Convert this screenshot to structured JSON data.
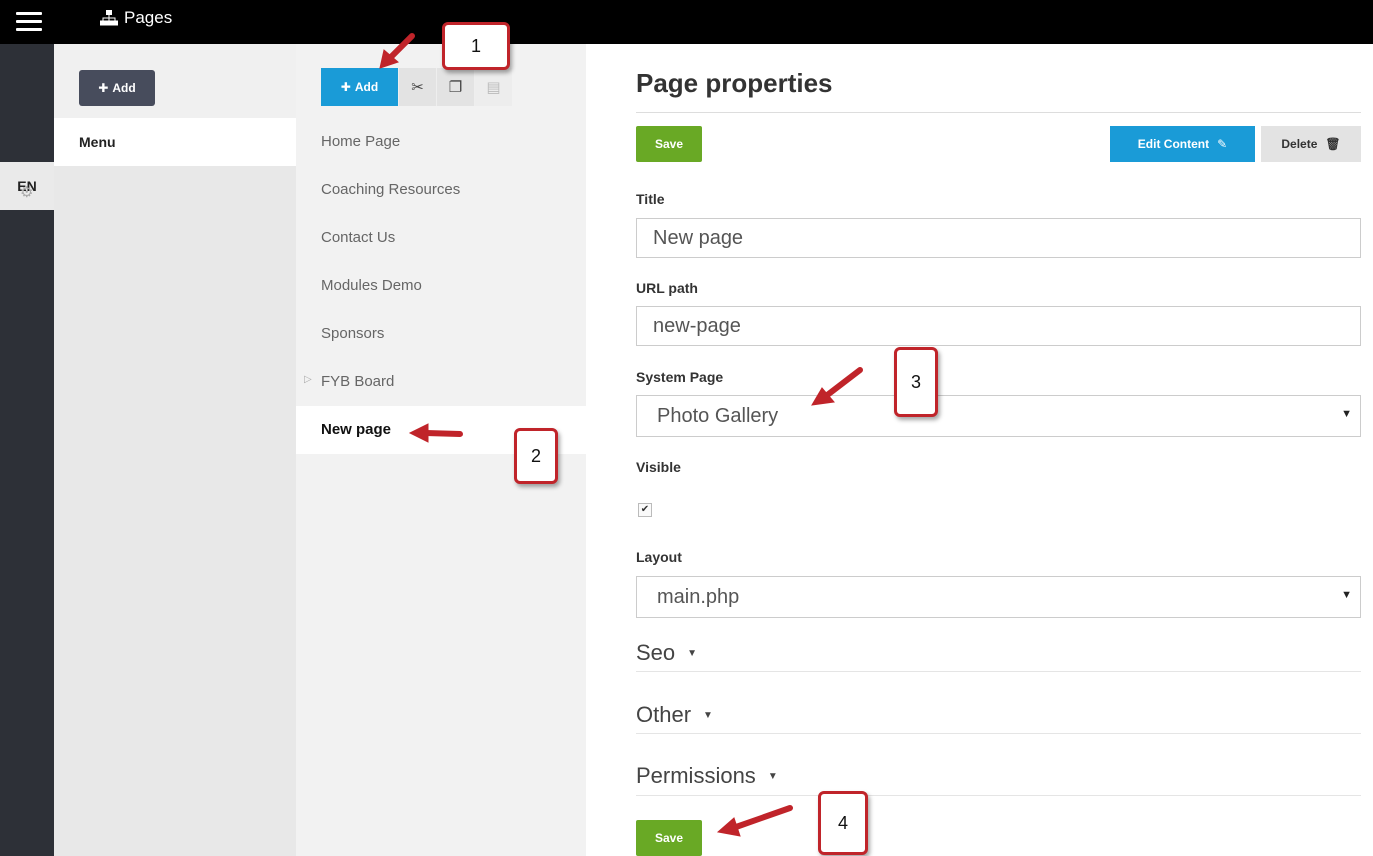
{
  "topbar": {
    "title": "Pages",
    "menu_icon": "hamburger-icon",
    "title_icon": "sitemap-icon"
  },
  "rail": {
    "language": "EN",
    "settings_icon": "gear-icon"
  },
  "menu_panel": {
    "add_label": "Add",
    "items": [
      {
        "label": "Menu"
      }
    ]
  },
  "pages_panel": {
    "add_label": "Add",
    "tools": [
      "cut-icon",
      "copy-icon",
      "paste-icon"
    ],
    "items": [
      {
        "label": "Home Page"
      },
      {
        "label": "Coaching Resources"
      },
      {
        "label": "Contact Us"
      },
      {
        "label": "Modules Demo"
      },
      {
        "label": "Sponsors"
      },
      {
        "label": "FYB Board",
        "has_children": true
      },
      {
        "label": "New page",
        "active": true
      }
    ]
  },
  "properties": {
    "heading": "Page properties",
    "save_label": "Save",
    "edit_content_label": "Edit Content",
    "delete_label": "Delete",
    "title_label": "Title",
    "title_value": "New page",
    "url_label": "URL path",
    "url_value": "new-page",
    "system_page_label": "System Page",
    "system_page_value": "Photo Gallery",
    "visible_label": "Visible",
    "visible_checked": true,
    "layout_label": "Layout",
    "layout_value": "main.php",
    "sections": [
      "Seo",
      "Other",
      "Permissions"
    ],
    "bottom_save_label": "Save"
  },
  "annotations": [
    "1",
    "2",
    "3",
    "4"
  ],
  "colors": {
    "accent_blue": "#1a9bd7",
    "save_green": "#69a925",
    "callout_red": "#c0242a",
    "topbar": "#000000"
  }
}
